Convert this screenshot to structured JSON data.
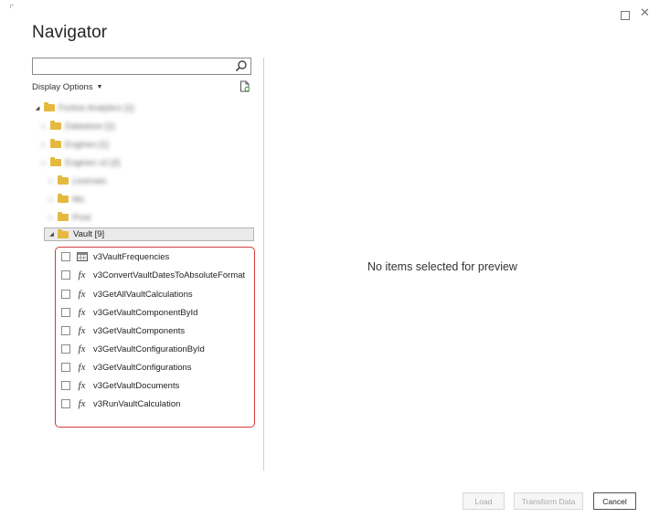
{
  "window": {
    "title": "Navigator",
    "maximize_icon": "maximize-icon",
    "close_glyph": "✕"
  },
  "search": {
    "value": "",
    "placeholder": "",
    "icon": "search-icon"
  },
  "display_options": {
    "label": "Display Options",
    "caret": "▼"
  },
  "tree": {
    "root_label": "Fortive Analytics [1]",
    "items": [
      {
        "label": "Datastore [1]"
      },
      {
        "label": "Engines [1]"
      },
      {
        "label": "Engines v2 [2]"
      },
      {
        "label": "Licenses"
      },
      {
        "label": "Mo"
      },
      {
        "label": "Prod"
      }
    ],
    "vault": {
      "label": "Vault [9]",
      "children": [
        {
          "label": "v3VaultFrequencies",
          "icon": "table-icon"
        },
        {
          "label": "v3ConvertVaultDatesToAbsoluteFormat",
          "icon": "fx-icon"
        },
        {
          "label": "v3GetAllVaultCalculations",
          "icon": "fx-icon"
        },
        {
          "label": "v3GetVaultComponentById",
          "icon": "fx-icon"
        },
        {
          "label": "v3GetVaultComponents",
          "icon": "fx-icon"
        },
        {
          "label": "v3GetVaultConfigurationById",
          "icon": "fx-icon"
        },
        {
          "label": "v3GetVaultConfigurations",
          "icon": "fx-icon"
        },
        {
          "label": "v3GetVaultDocuments",
          "icon": "fx-icon"
        },
        {
          "label": "v3RunVaultCalculation",
          "icon": "fx-icon"
        }
      ]
    },
    "fx_glyph": "fx",
    "expanded_glyph": "◢",
    "collapsed_glyph": "▷"
  },
  "preview": {
    "empty_message": "No items selected for preview"
  },
  "footer": {
    "load_label": "Load",
    "transform_label": "Transform Data",
    "cancel_label": "Cancel"
  },
  "colors": {
    "highlight_border": "#d23c3c",
    "folder": "#e5b93f",
    "disabled_text": "#a8a8a8"
  }
}
